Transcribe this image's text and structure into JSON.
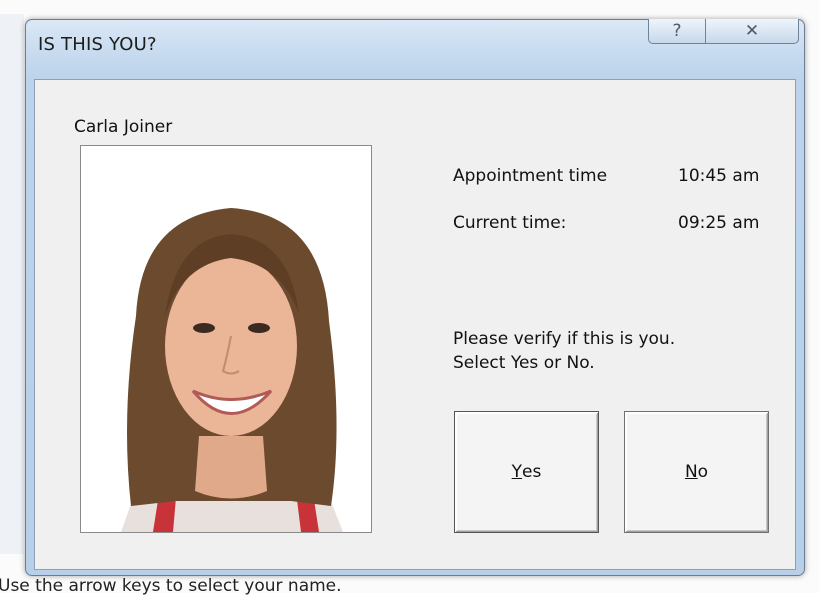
{
  "window": {
    "title": "IS THIS YOU?",
    "help_glyph": "?",
    "close_glyph": "✕"
  },
  "person": {
    "name": "Carla Joiner"
  },
  "info": {
    "appointment_label": "Appointment time",
    "appointment_value": "10:45 am",
    "current_label": "Current time:",
    "current_value": "09:25 am"
  },
  "prompt": {
    "line1": "Please verify if this is you.",
    "line2": "Select Yes or No."
  },
  "buttons": {
    "yes_mnemonic": "Y",
    "yes_rest": "es",
    "no_mnemonic": "N",
    "no_rest": "o"
  },
  "background": {
    "hint": "Use the arrow keys to select your name."
  }
}
